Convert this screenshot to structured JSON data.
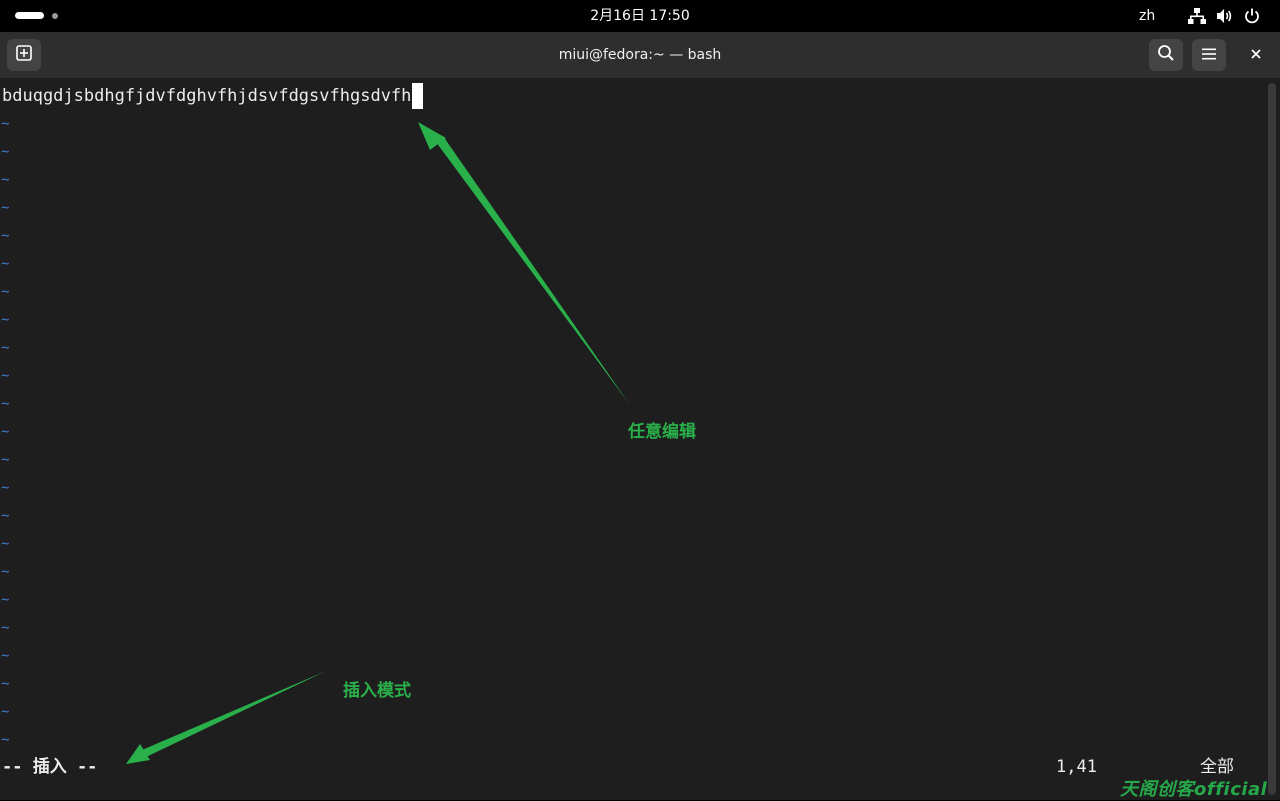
{
  "topbar": {
    "clock": "2月16日  17:50",
    "input_method": "zh",
    "icons": [
      "network-icon",
      "volume-icon",
      "power-icon"
    ]
  },
  "window": {
    "title": "miui@fedora:~ — bash",
    "icons": [
      "new-tab-icon",
      "search-icon",
      "hamburger-menu-icon",
      "close-icon"
    ]
  },
  "editor": {
    "line1": "bduqgdjsbdhgfjdvfdghvfhjdsvfdgsvfhgsdvfh",
    "tilde": "~",
    "tilde_count": 23,
    "mode": "-- 插入 --",
    "position": "1,41",
    "scroll": "全部"
  },
  "annotations": {
    "edit_label": "任意编辑",
    "insert_label": "插入模式",
    "color": "#2ab04a"
  },
  "watermark": "天阁创客official"
}
